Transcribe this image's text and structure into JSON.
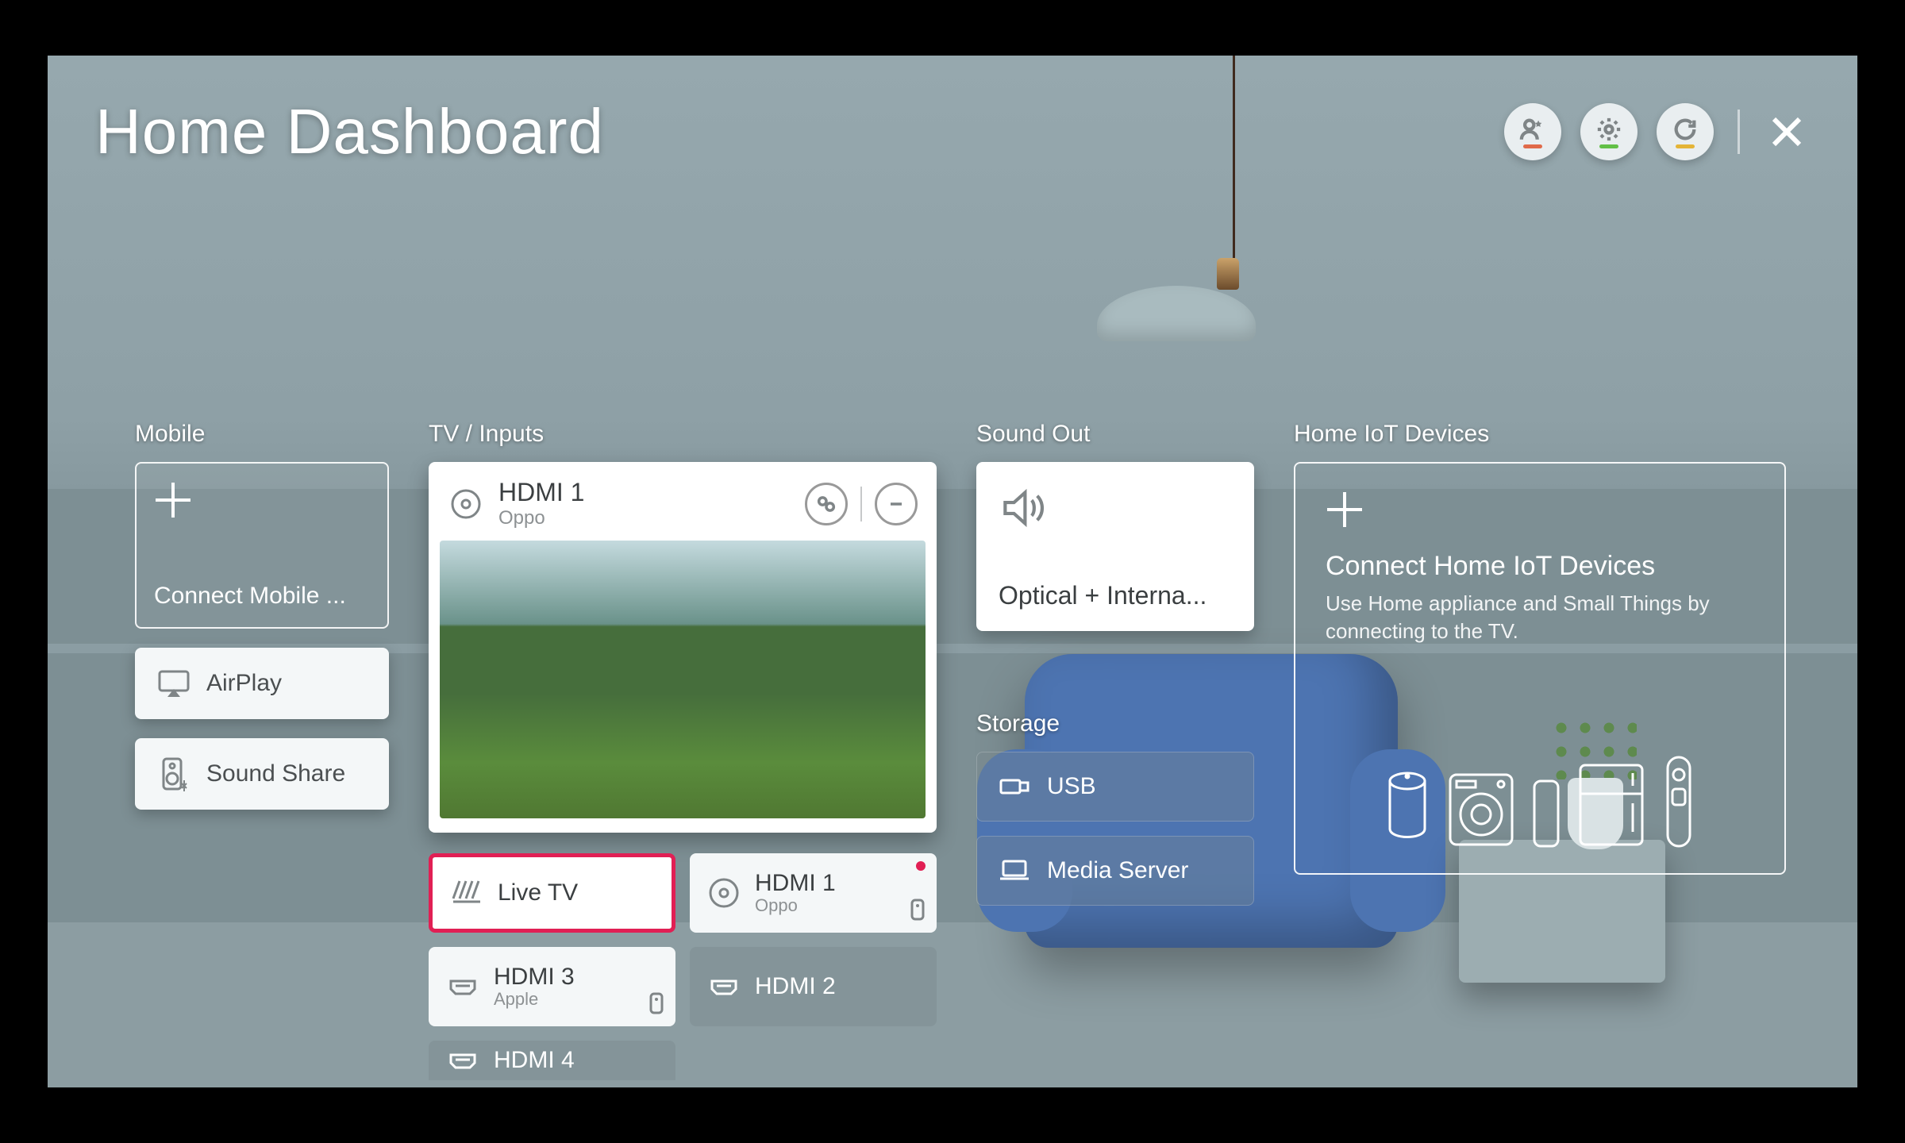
{
  "header": {
    "title": "Home Dashboard",
    "status_colors": {
      "account": "#e06a4a",
      "settings": "#62c047",
      "refresh": "#e4b437"
    }
  },
  "mobile": {
    "title": "Mobile",
    "connect_label": "Connect Mobile ...",
    "items": [
      {
        "label": "AirPlay"
      },
      {
        "label": "Sound Share"
      }
    ]
  },
  "tv": {
    "title": "TV / Inputs",
    "featured": {
      "name": "HDMI 1",
      "sub": "Oppo"
    },
    "inputs": [
      {
        "name": "Live TV",
        "sub": "",
        "selected": true,
        "style": "sel"
      },
      {
        "name": "HDMI 1",
        "sub": "Oppo",
        "active_dot": true,
        "remote": true,
        "style": "solid"
      },
      {
        "name": "HDMI 3",
        "sub": "Apple",
        "remote": true,
        "style": "solid"
      },
      {
        "name": "HDMI 2",
        "sub": "",
        "style": "ghost"
      }
    ],
    "partial": {
      "name": "HDMI 4"
    }
  },
  "sound": {
    "title": "Sound Out",
    "current": "Optical + Interna..."
  },
  "storage": {
    "title": "Storage",
    "items": [
      {
        "label": "USB"
      },
      {
        "label": "Media Server"
      }
    ]
  },
  "iot": {
    "title": "Home IoT Devices",
    "headline": "Connect Home IoT Devices",
    "sub": "Use Home appliance and Small Things by connecting to the TV."
  }
}
